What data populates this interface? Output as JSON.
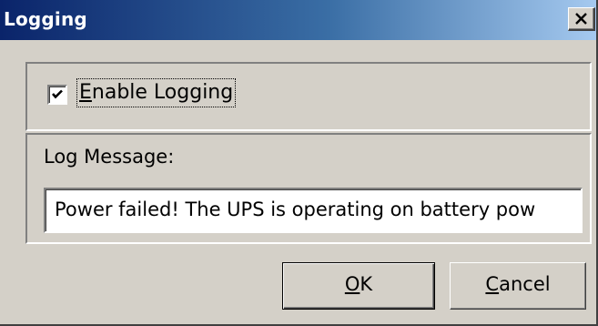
{
  "window": {
    "title": "Logging"
  },
  "titlebar": {
    "close_icon": "close-icon"
  },
  "logging": {
    "enable_checked": true,
    "enable_label_prefix": "",
    "enable_label_mnemonic": "E",
    "enable_label_rest": "nable Logging"
  },
  "message": {
    "label": "Log Message:",
    "value": "Power failed! The UPS is operating on battery pow"
  },
  "buttons": {
    "ok_mnemonic": "O",
    "ok_rest": "K",
    "cancel_mnemonic": "C",
    "cancel_rest": "ancel"
  },
  "colors": {
    "titlebar_start": "#0a246a",
    "titlebar_end": "#a6caf0",
    "face": "#d4d0c8"
  }
}
